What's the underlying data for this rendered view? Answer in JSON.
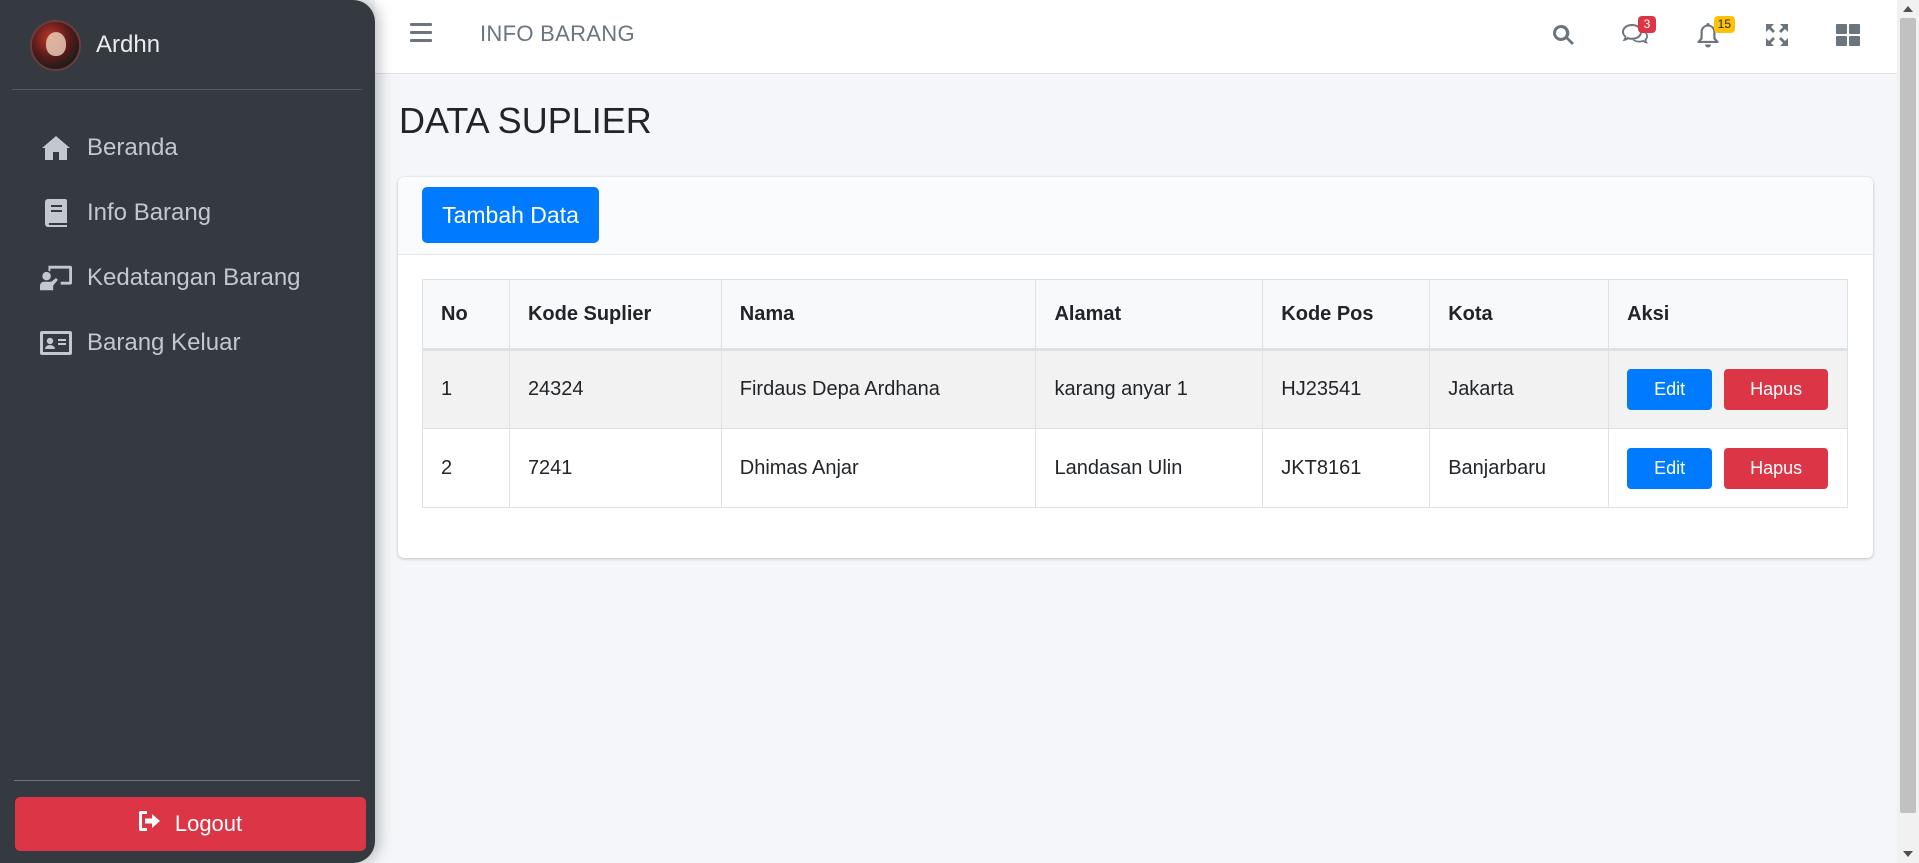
{
  "sidebar": {
    "user_name": "Ardhn",
    "items": [
      {
        "label": "Beranda",
        "icon": "home-icon"
      },
      {
        "label": "Info Barang",
        "icon": "book-icon"
      },
      {
        "label": "Kedatangan Barang",
        "icon": "chalkboard-teacher-icon"
      },
      {
        "label": "Barang Keluar",
        "icon": "id-card-icon"
      }
    ],
    "logout_label": "Logout"
  },
  "topbar": {
    "title": "INFO BARANG",
    "messages_badge": "3",
    "notifications_badge": "15"
  },
  "main": {
    "page_title": "DATA SUPLIER",
    "add_button": "Tambah Data",
    "table": {
      "headers": [
        "No",
        "Kode Suplier",
        "Nama",
        "Alamat",
        "Kode Pos",
        "Kota",
        "Aksi"
      ],
      "rows": [
        {
          "no": "1",
          "kode": "24324",
          "nama": "Firdaus Depa Ardhana",
          "alamat": "karang anyar 1",
          "kode_pos": "HJ23541",
          "kota": "Jakarta"
        },
        {
          "no": "2",
          "kode": "7241",
          "nama": "Dhimas Anjar",
          "alamat": "Landasan Ulin",
          "kode_pos": "JKT8161",
          "kota": "Banjarbaru"
        }
      ],
      "edit_label": "Edit",
      "delete_label": "Hapus"
    }
  },
  "colors": {
    "sidebar_bg": "#343a40",
    "primary": "#007bff",
    "danger": "#dc3545",
    "warning": "#ffc107"
  }
}
